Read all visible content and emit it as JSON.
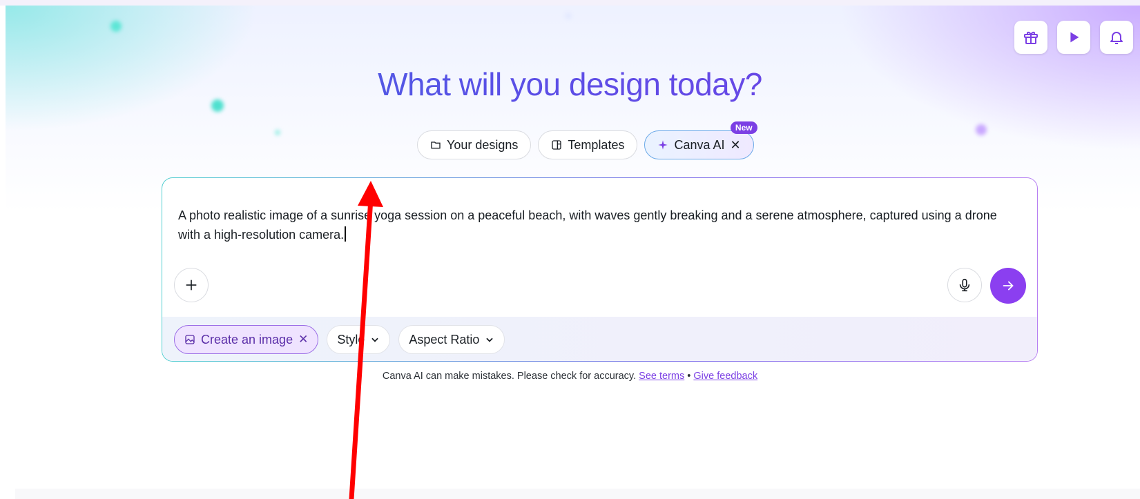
{
  "headline": "What will you design today?",
  "tabs": [
    {
      "label": "Your designs",
      "icon": "folder-icon"
    },
    {
      "label": "Templates",
      "icon": "template-icon"
    },
    {
      "label": "Canva AI",
      "icon": "sparkle-icon",
      "badge": "New",
      "close": "✕"
    }
  ],
  "top_icons": [
    "gift-icon",
    "play-icon",
    "bell-icon"
  ],
  "prompt": {
    "text": "A photo realistic image of a sunrise yoga session on a peaceful beach, with waves gently breaking and a serene atmosphere, captured using a drone with a high-resolution camera."
  },
  "options": {
    "create_image": "Create an image",
    "style": "Style",
    "aspect_ratio": "Aspect Ratio"
  },
  "disclaimer": {
    "text": "Canva AI can make mistakes. Please check for accuracy.",
    "see_terms": "See terms",
    "separator": "•",
    "give_feedback": "Give feedback"
  },
  "colors": {
    "accent": "#8b3ff0",
    "badge": "#7b3fe4",
    "annotation_arrow": "#ff0000"
  }
}
